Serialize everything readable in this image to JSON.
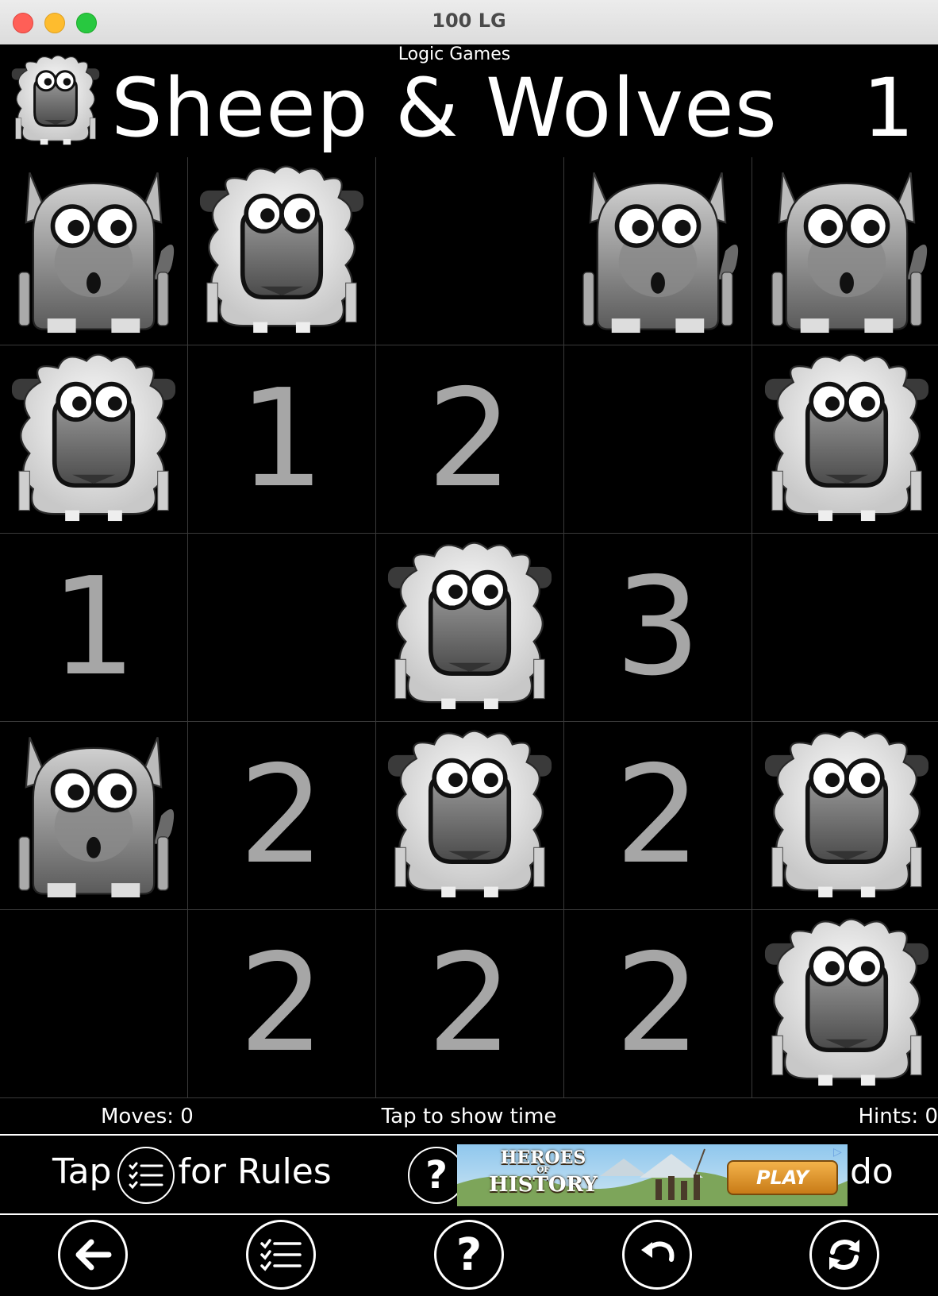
{
  "window": {
    "title": "100 LG"
  },
  "header": {
    "subtitle": "Logic Games",
    "title": "Sheep & Wolves",
    "level": "1"
  },
  "grid": {
    "rows": [
      [
        {
          "type": "wolf"
        },
        {
          "type": "sheep"
        },
        {
          "type": "empty"
        },
        {
          "type": "wolf"
        },
        {
          "type": "wolf"
        }
      ],
      [
        {
          "type": "sheep"
        },
        {
          "type": "number",
          "value": "1"
        },
        {
          "type": "number",
          "value": "2"
        },
        {
          "type": "empty"
        },
        {
          "type": "sheep"
        }
      ],
      [
        {
          "type": "number",
          "value": "1"
        },
        {
          "type": "empty"
        },
        {
          "type": "sheep"
        },
        {
          "type": "number",
          "value": "3"
        },
        {
          "type": "empty"
        }
      ],
      [
        {
          "type": "wolf"
        },
        {
          "type": "number",
          "value": "2"
        },
        {
          "type": "sheep"
        },
        {
          "type": "number",
          "value": "2"
        },
        {
          "type": "sheep"
        }
      ],
      [
        {
          "type": "empty"
        },
        {
          "type": "number",
          "value": "2"
        },
        {
          "type": "number",
          "value": "2"
        },
        {
          "type": "number",
          "value": "2"
        },
        {
          "type": "sheep"
        }
      ]
    ]
  },
  "status": {
    "moves": "Moves: 0",
    "time": "Tap to show time",
    "hints": "Hints: 0"
  },
  "banner": {
    "rules_prefix": "Tap",
    "rules_suffix": "for Rules",
    "help_symbol": "?",
    "undo_partial": "do",
    "ad": {
      "line1": "HEROES",
      "line2": "OF",
      "line3": "HISTORY",
      "button": "PLAY"
    }
  },
  "toolbar": {
    "help_symbol": "?",
    "icons": [
      "back-arrow-icon",
      "rules-list-icon",
      "help-icon",
      "undo-icon",
      "refresh-icon"
    ]
  },
  "colors": {
    "background": "#000000",
    "number": "#a6a6a6",
    "grid_line": "#3a3a3a"
  }
}
